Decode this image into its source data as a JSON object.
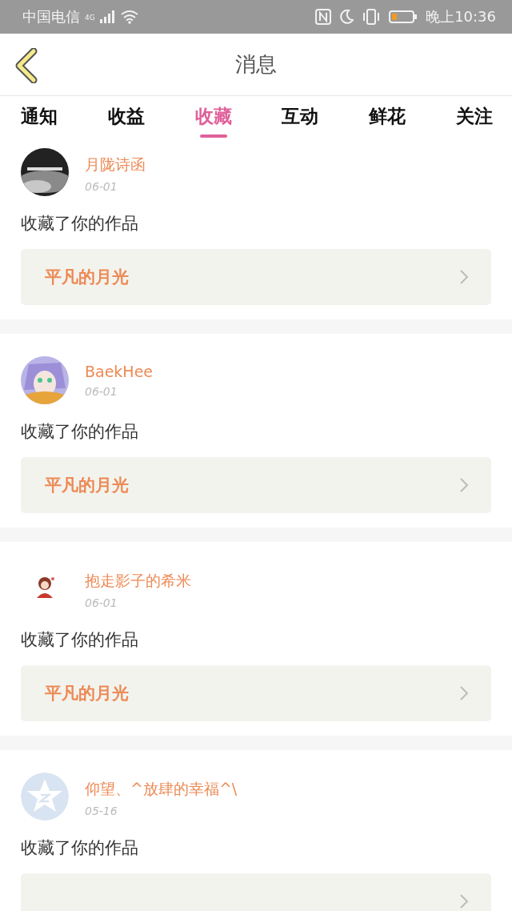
{
  "status_bar": {
    "carrier": "中国电信",
    "network": "4G",
    "time": "晚上10:36"
  },
  "header": {
    "title": "消息"
  },
  "tabs": [
    {
      "label": "通知",
      "selected": false
    },
    {
      "label": "收益",
      "selected": false
    },
    {
      "label": "收藏",
      "selected": true
    },
    {
      "label": "互动",
      "selected": false
    },
    {
      "label": "鲜花",
      "selected": false
    },
    {
      "label": "关注",
      "selected": false
    }
  ],
  "messages": [
    {
      "name": "月陇诗函",
      "date": "06-01",
      "text": "收藏了你的作品",
      "work": "平凡的月光"
    },
    {
      "name": "BaekHee",
      "date": "06-01",
      "text": "收藏了你的作品",
      "work": "平凡的月光"
    },
    {
      "name": "抱走影子的希米",
      "date": "06-01",
      "text": "收藏了你的作品",
      "work": "平凡的月光"
    },
    {
      "avatar": {
        "kind": "default"
      },
      "name": "仰望、^放肆的幸福^\\",
      "date": "05-16",
      "text": "收藏了你的作品"
    }
  ]
}
